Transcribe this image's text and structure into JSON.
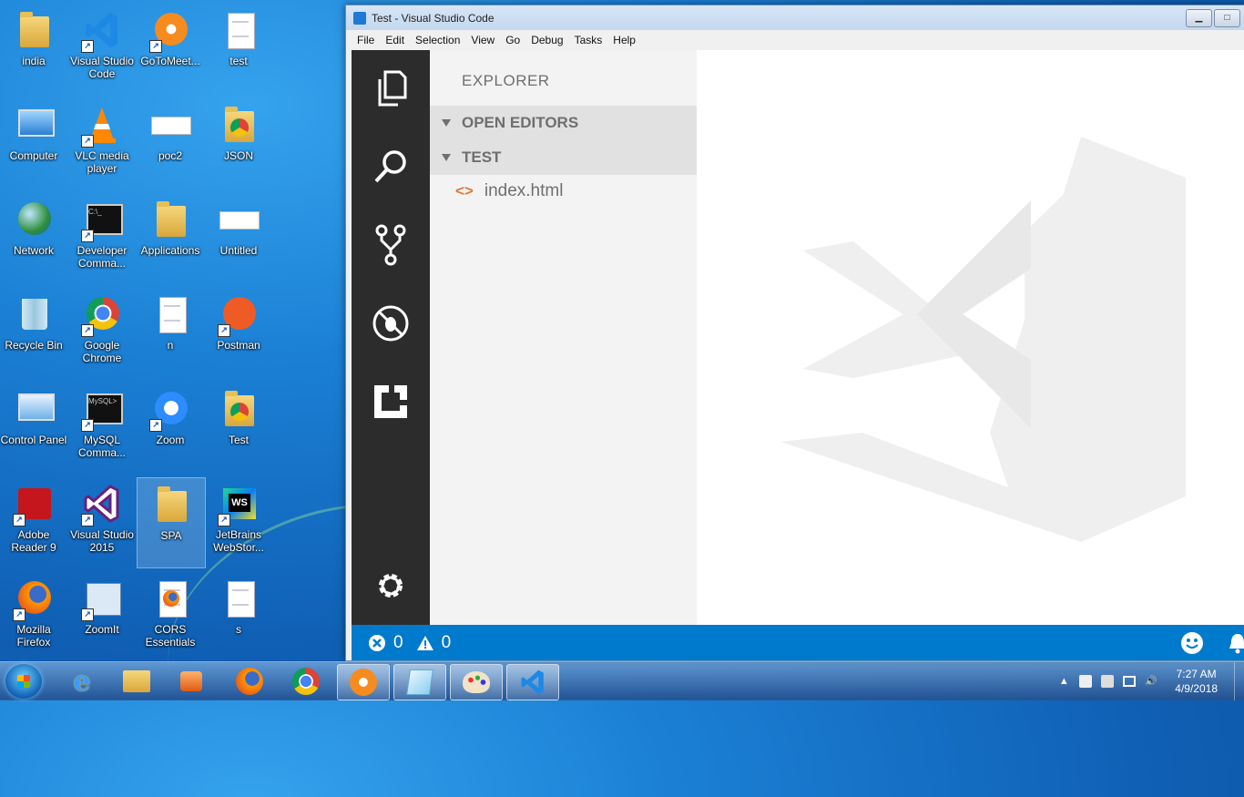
{
  "desktop": {
    "icons": [
      {
        "label": "india"
      },
      {
        "label": "Visual Studio Code"
      },
      {
        "label": "GoToMeet..."
      },
      {
        "label": "test"
      },
      {
        "label": "Computer"
      },
      {
        "label": "VLC media player"
      },
      {
        "label": "poc2"
      },
      {
        "label": "JSON"
      },
      {
        "label": "Network"
      },
      {
        "label": "Developer Comma..."
      },
      {
        "label": "Applications"
      },
      {
        "label": "Untitled"
      },
      {
        "label": "Recycle Bin"
      },
      {
        "label": "Google Chrome"
      },
      {
        "label": "n"
      },
      {
        "label": "Postman"
      },
      {
        "label": "Control Panel"
      },
      {
        "label": "MySQL Comma..."
      },
      {
        "label": "Zoom"
      },
      {
        "label": "Test"
      },
      {
        "label": "Adobe Reader 9"
      },
      {
        "label": "Visual Studio 2015"
      },
      {
        "label": "SPA"
      },
      {
        "label": "JetBrains WebStor..."
      },
      {
        "label": "Mozilla Firefox"
      },
      {
        "label": "ZoomIt"
      },
      {
        "label": "CORS Essentials"
      },
      {
        "label": "s"
      }
    ]
  },
  "window": {
    "title": "Test - Visual Studio Code",
    "minimize_glyph": "▁",
    "maximize_glyph": "□"
  },
  "menu": [
    "File",
    "Edit",
    "Selection",
    "View",
    "Go",
    "Debug",
    "Tasks",
    "Help"
  ],
  "activity_bar": [
    "files-icon",
    "search-icon",
    "source-control-icon",
    "debug-icon",
    "extensions-icon",
    "settings-gear-icon"
  ],
  "sidebar": {
    "title": "EXPLORER",
    "open_editors": "OPEN EDITORS",
    "folder": "TEST",
    "files": [
      {
        "glyph": "<>",
        "name": "index.html"
      }
    ]
  },
  "statusbar": {
    "errors": "0",
    "warnings": "0"
  },
  "taskbar": {
    "time": "7:27 AM",
    "date": "4/9/2018"
  },
  "colors": {
    "statusbar": "#007acc",
    "activity_bar": "#2c2c2c",
    "sidebar": "#f3f3f3",
    "file_icon": "#e37933"
  }
}
